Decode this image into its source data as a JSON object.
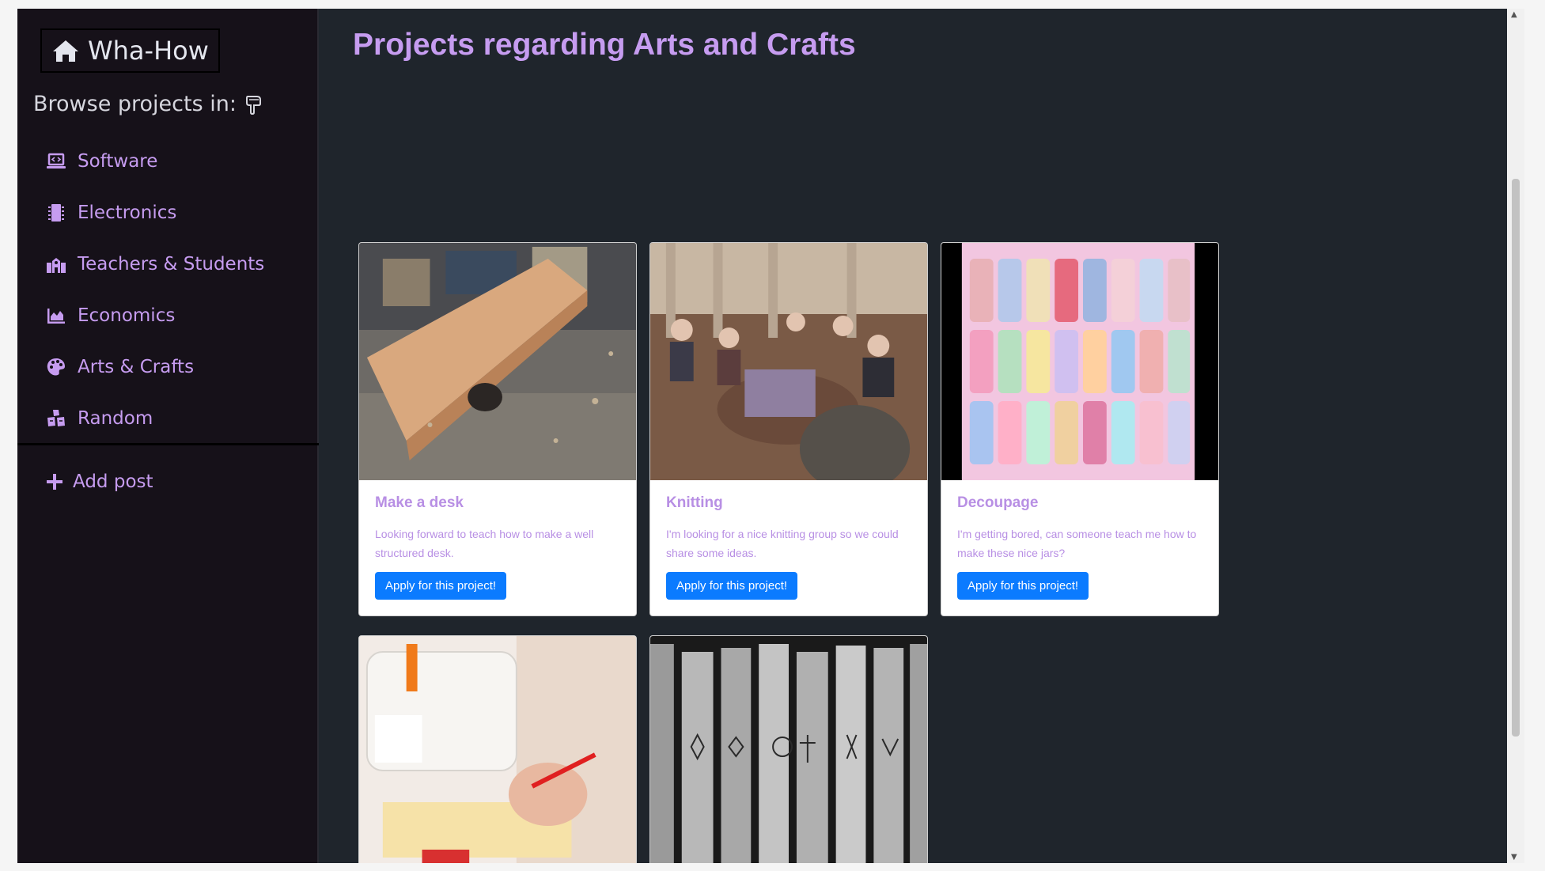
{
  "brand": {
    "name": "Wha-How",
    "icon": "home-icon"
  },
  "sidebar": {
    "browse_label": "Browse projects in:",
    "browse_icon": "hand-point-down-icon",
    "items": [
      {
        "label": "Software",
        "icon": "laptop-code-icon"
      },
      {
        "label": "Electronics",
        "icon": "microchip-icon"
      },
      {
        "label": "Teachers & Students",
        "icon": "school-icon"
      },
      {
        "label": "Economics",
        "icon": "chart-area-icon"
      },
      {
        "label": "Arts & Crafts",
        "icon": "palette-icon"
      },
      {
        "label": "Random",
        "icon": "cubes-icon"
      }
    ],
    "add_post": "Add post"
  },
  "page": {
    "title": "Projects regarding Arts and Crafts"
  },
  "cards": [
    {
      "title": "Make a desk",
      "text": "Looking forward to teach how to make a well structured desk.",
      "button": "Apply for this project!"
    },
    {
      "title": "Knitting",
      "text": "I'm looking for a nice knitting group so we could share some ideas.",
      "button": "Apply for this project!"
    },
    {
      "title": "Decoupage",
      "text": "I'm getting bored, can someone teach me how to make these nice jars?",
      "button": "Apply for this project!"
    },
    {
      "title": "",
      "text": "",
      "button": ""
    },
    {
      "title": "",
      "text": "",
      "button": ""
    }
  ],
  "colors": {
    "accent": "#c69cf0",
    "sidebar_bg": "#161119",
    "main_bg": "#1f252c",
    "button": "#0b7bff"
  }
}
